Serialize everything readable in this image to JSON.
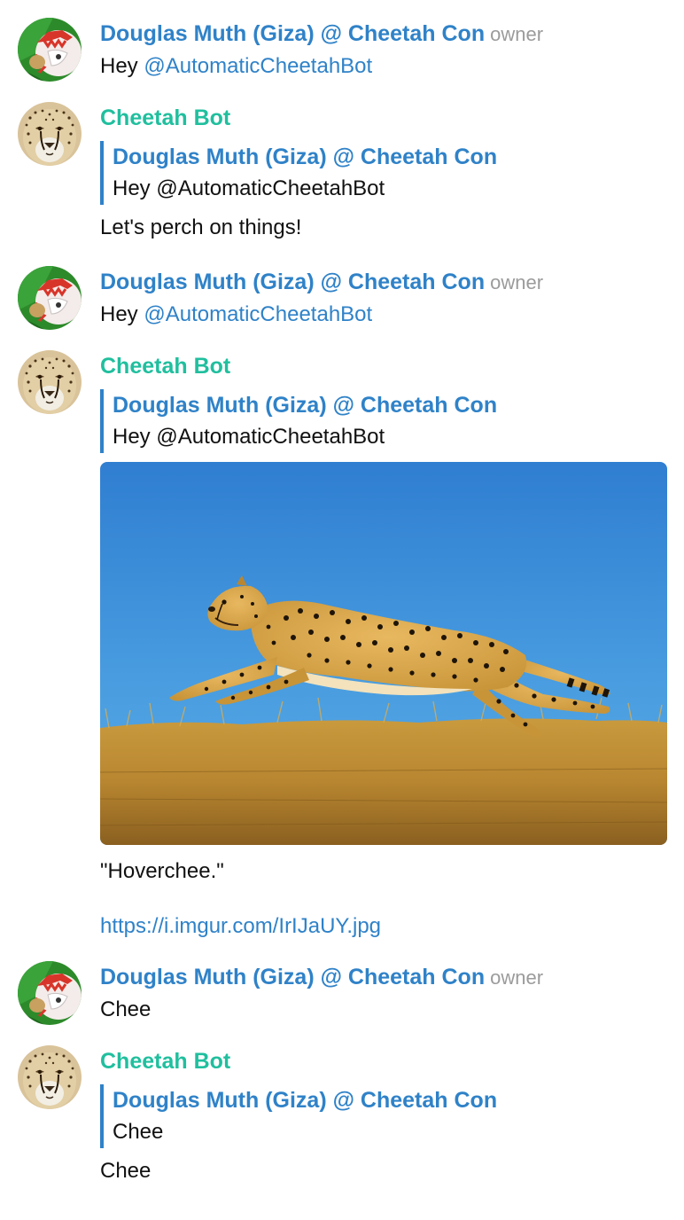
{
  "colors": {
    "user_name": "#2f82c8",
    "bot_name": "#20bf9e",
    "role": "#9b9b9b",
    "link": "#2f82c8",
    "quote_bar": "#2f82c8"
  },
  "messages": [
    {
      "sender": "Douglas Muth (Giza) @ Cheetah Con",
      "role": "owner",
      "avatar": "giza-avatar",
      "text_prefix": "Hey ",
      "mention": "@AutomaticCheetahBot"
    },
    {
      "sender": "Cheetah Bot",
      "avatar": "cheetah-avatar",
      "quote": {
        "sender": "Douglas Muth (Giza) @ Cheetah Con",
        "text": "Hey @AutomaticCheetahBot"
      },
      "text": "Let's perch on things!"
    },
    {
      "sender": "Douglas Muth (Giza) @ Cheetah Con",
      "role": "owner",
      "avatar": "giza-avatar",
      "text_prefix": "Hey ",
      "mention": "@AutomaticCheetahBot"
    },
    {
      "sender": "Cheetah Bot",
      "avatar": "cheetah-avatar",
      "quote": {
        "sender": "Douglas Muth (Giza) @ Cheetah Con",
        "text": "Hey @AutomaticCheetahBot"
      },
      "image": "running-cheetah-photo",
      "caption": "\"Hoverchee.\"",
      "link": "https://i.imgur.com/IrIJaUY.jpg"
    },
    {
      "sender": "Douglas Muth (Giza) @ Cheetah Con",
      "role": "owner",
      "avatar": "giza-avatar",
      "text": "Chee"
    },
    {
      "sender": "Cheetah Bot",
      "avatar": "cheetah-avatar",
      "quote": {
        "sender": "Douglas Muth (Giza) @ Cheetah Con",
        "text": "Chee"
      },
      "text": "Chee"
    }
  ]
}
